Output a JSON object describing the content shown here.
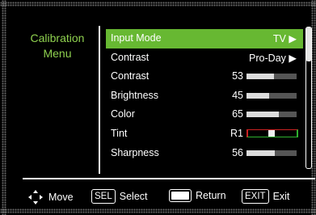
{
  "menu": {
    "title_line1": "Calibration",
    "title_line2": "Menu"
  },
  "items": [
    {
      "label": "Input Mode",
      "value": "TV",
      "arrow": "▶",
      "selected": true
    },
    {
      "label": "Contrast",
      "value": "Pro-Day",
      "arrow": "▶"
    },
    {
      "label": "Contrast",
      "number": "53",
      "level": 0.55
    },
    {
      "label": "Brightness",
      "number": "45",
      "level": 0.45
    },
    {
      "label": "Color",
      "number": "65",
      "level": 0.65
    },
    {
      "label": "Tint",
      "number": "R1",
      "level": 0.49
    },
    {
      "label": "Sharpness",
      "number": "56",
      "level": 0.56
    }
  ],
  "footer": {
    "move_label": "Move",
    "sel_key": "SEL",
    "select_label": "Select",
    "return_label": "Return",
    "exit_key": "EXIT",
    "exit_label": "Exit"
  },
  "colors": {
    "accent": "#67b832",
    "title": "#8fd14f"
  }
}
